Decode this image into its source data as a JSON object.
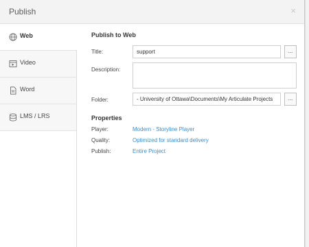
{
  "dialog": {
    "title": "Publish",
    "close_glyph": "×"
  },
  "sidebar": {
    "items": [
      {
        "label": "Web",
        "icon": "globe-icon",
        "active": true
      },
      {
        "label": "Video",
        "icon": "video-icon",
        "active": false
      },
      {
        "label": "Word",
        "icon": "word-document-icon",
        "active": false
      },
      {
        "label": "LMS / LRS",
        "icon": "database-icon",
        "active": false
      }
    ]
  },
  "main": {
    "heading": "Publish to Web",
    "title_label": "Title:",
    "title_value": "support",
    "description_label": "Description:",
    "description_value": "",
    "folder_label": "Folder:",
    "folder_value": "- University of Ottawa\\Documents\\My Articulate Projects",
    "browse_label": "...",
    "properties_heading": "Properties",
    "properties": [
      {
        "label": "Player:",
        "value": "Modern - Storyline Player"
      },
      {
        "label": "Quality:",
        "value": "Optimized for standard delivery"
      },
      {
        "label": "Publish:",
        "value": "Entire Project"
      }
    ]
  },
  "colors": {
    "link": "#3a8ccc",
    "titlebar": "#f3f3f3",
    "sidebar_inactive": "#f7f7f7"
  }
}
